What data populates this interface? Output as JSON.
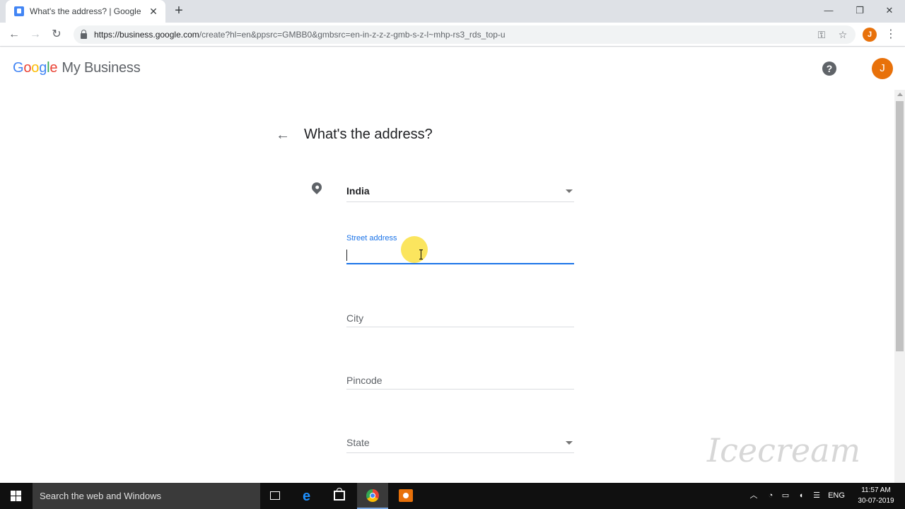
{
  "browser": {
    "tab_title": "What's the address? | Google My",
    "new_tab_icon": "plus-icon",
    "url_host": "https://business.google.com",
    "url_path": "/create?hl=en&ppsrc=GMBB0&gmbsrc=en-in-z-z-z-gmb-s-z-l~mhp-rs3_rds_top-u",
    "profile_initial": "J"
  },
  "header": {
    "brand_google": [
      "G",
      "o",
      "o",
      "g",
      "l",
      "e"
    ],
    "brand_product": "My Business",
    "help_glyph": "?",
    "avatar_initial": "J"
  },
  "form": {
    "title": "What's the address?",
    "country_value": "India",
    "street_label": "Street address",
    "street_value": "",
    "city_placeholder": "City",
    "pincode_placeholder": "Pincode",
    "state_placeholder": "State"
  },
  "taskbar": {
    "search_placeholder": "Search the web and Windows",
    "language": "ENG",
    "time": "11:57 AM",
    "date": "30-07-2019"
  },
  "watermark_text": "Icecream",
  "colors": {
    "accent_blue": "#1a73e8",
    "avatar_orange": "#e8710a",
    "google_blue": "#4285f4",
    "google_red": "#ea4335",
    "google_yellow": "#fbbc05",
    "google_green": "#34a853",
    "taskbar_bg": "#101010"
  }
}
